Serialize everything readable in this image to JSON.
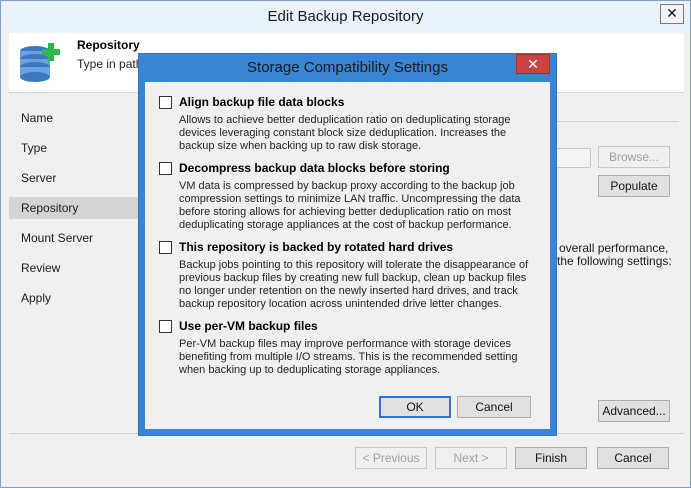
{
  "window": {
    "title": "Edit Backup Repository",
    "close_glyph": "✕"
  },
  "header": {
    "title": "Repository",
    "description": "Type in path t",
    "icon": "database-add-icon"
  },
  "sidebar": {
    "steps": [
      {
        "label": "Name"
      },
      {
        "label": "Type"
      },
      {
        "label": "Server"
      },
      {
        "label": "Repository",
        "active": true
      },
      {
        "label": "Mount Server"
      },
      {
        "label": "Review"
      },
      {
        "label": "Apply"
      }
    ]
  },
  "content": {
    "text_line_1": "e overall performance,",
    "text_line_2": "the following settings:"
  },
  "buttons": {
    "browse": "Browse...",
    "populate": "Populate",
    "advanced": "Advanced...",
    "previous": "< Previous",
    "next": "Next >",
    "finish": "Finish",
    "cancel": "Cancel"
  },
  "dialog": {
    "title": "Storage Compatibility Settings",
    "close_glyph": "✕",
    "options": [
      {
        "label": "Align backup file data blocks",
        "checked": false,
        "description": "Allows to achieve better deduplication ratio on deduplicating storage devices leveraging constant block size deduplication. Increases the backup size when backing up to raw disk storage."
      },
      {
        "label": "Decompress backup data blocks before storing",
        "checked": false,
        "description": "VM data is compressed by backup proxy according to the backup job compression settings to minimize LAN traffic. Uncompressing the data before storing allows for achieving better deduplication ratio on most deduplicating storage appliances at the cost of backup performance."
      },
      {
        "label": "This repository is backed by rotated hard drives",
        "checked": false,
        "description": "Backup jobs pointing to this repository will tolerate the disappearance of previous backup files by creating new full backup, clean up backup files no longer under retention on the newly inserted hard drives, and track backup repository location across unintended drive letter changes."
      },
      {
        "label": "Use per-VM backup files",
        "checked": false,
        "description": "Per-VM backup files may improve performance with storage devices benefiting from multiple I/O streams. This is the recommended setting when backing up to deduplicating storage appliances."
      }
    ],
    "ok_label": "OK",
    "cancel_label": "Cancel"
  },
  "colors": {
    "accent": "#3a84d4",
    "close_red": "#c74545",
    "window_bg": "#f0f0f0"
  }
}
